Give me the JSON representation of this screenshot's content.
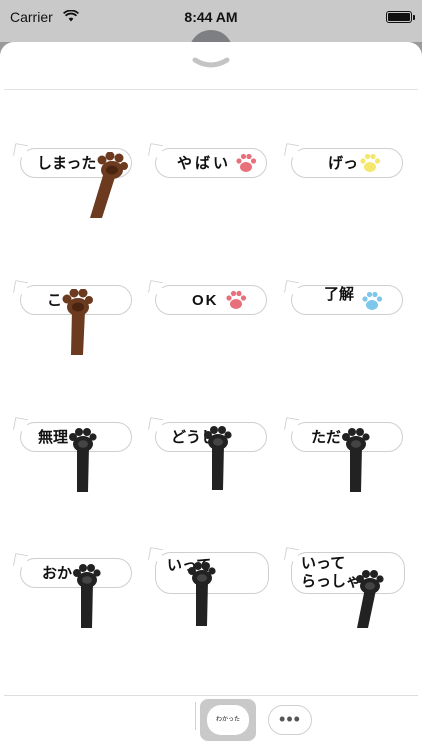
{
  "status_bar": {
    "carrier": "Carrier",
    "time": "8:44 AM"
  },
  "stickers": [
    {
      "text": "しまった",
      "paw": "brown-arm"
    },
    {
      "text": "やばい",
      "paw": "pink"
    },
    {
      "text": "げっ",
      "paw": "yellow"
    },
    {
      "text": "こ",
      "paw": "brown-arm"
    },
    {
      "text": "OK",
      "paw": "pink"
    },
    {
      "text": "了解",
      "paw": "blue"
    },
    {
      "text": "無理",
      "paw": "black-arm"
    },
    {
      "text": "どうし",
      "paw": "black-arm"
    },
    {
      "text": "ただ",
      "paw": "black-arm"
    },
    {
      "text": "おか",
      "paw": "black-arm"
    },
    {
      "text": "いって",
      "paw": "black-arm"
    },
    {
      "text_line1": "いって",
      "text_line2": "らっしゃ",
      "paw": "black-arm"
    }
  ],
  "tray": {
    "selected_app_label": "わかった",
    "more_label": "•••"
  },
  "colors": {
    "brown": "#6b3a1f",
    "brown_dark": "#4a2410",
    "black_paw": "#222222",
    "pink": "#e8707a",
    "yellow": "#f4e76b",
    "blue": "#7cc7ea"
  }
}
